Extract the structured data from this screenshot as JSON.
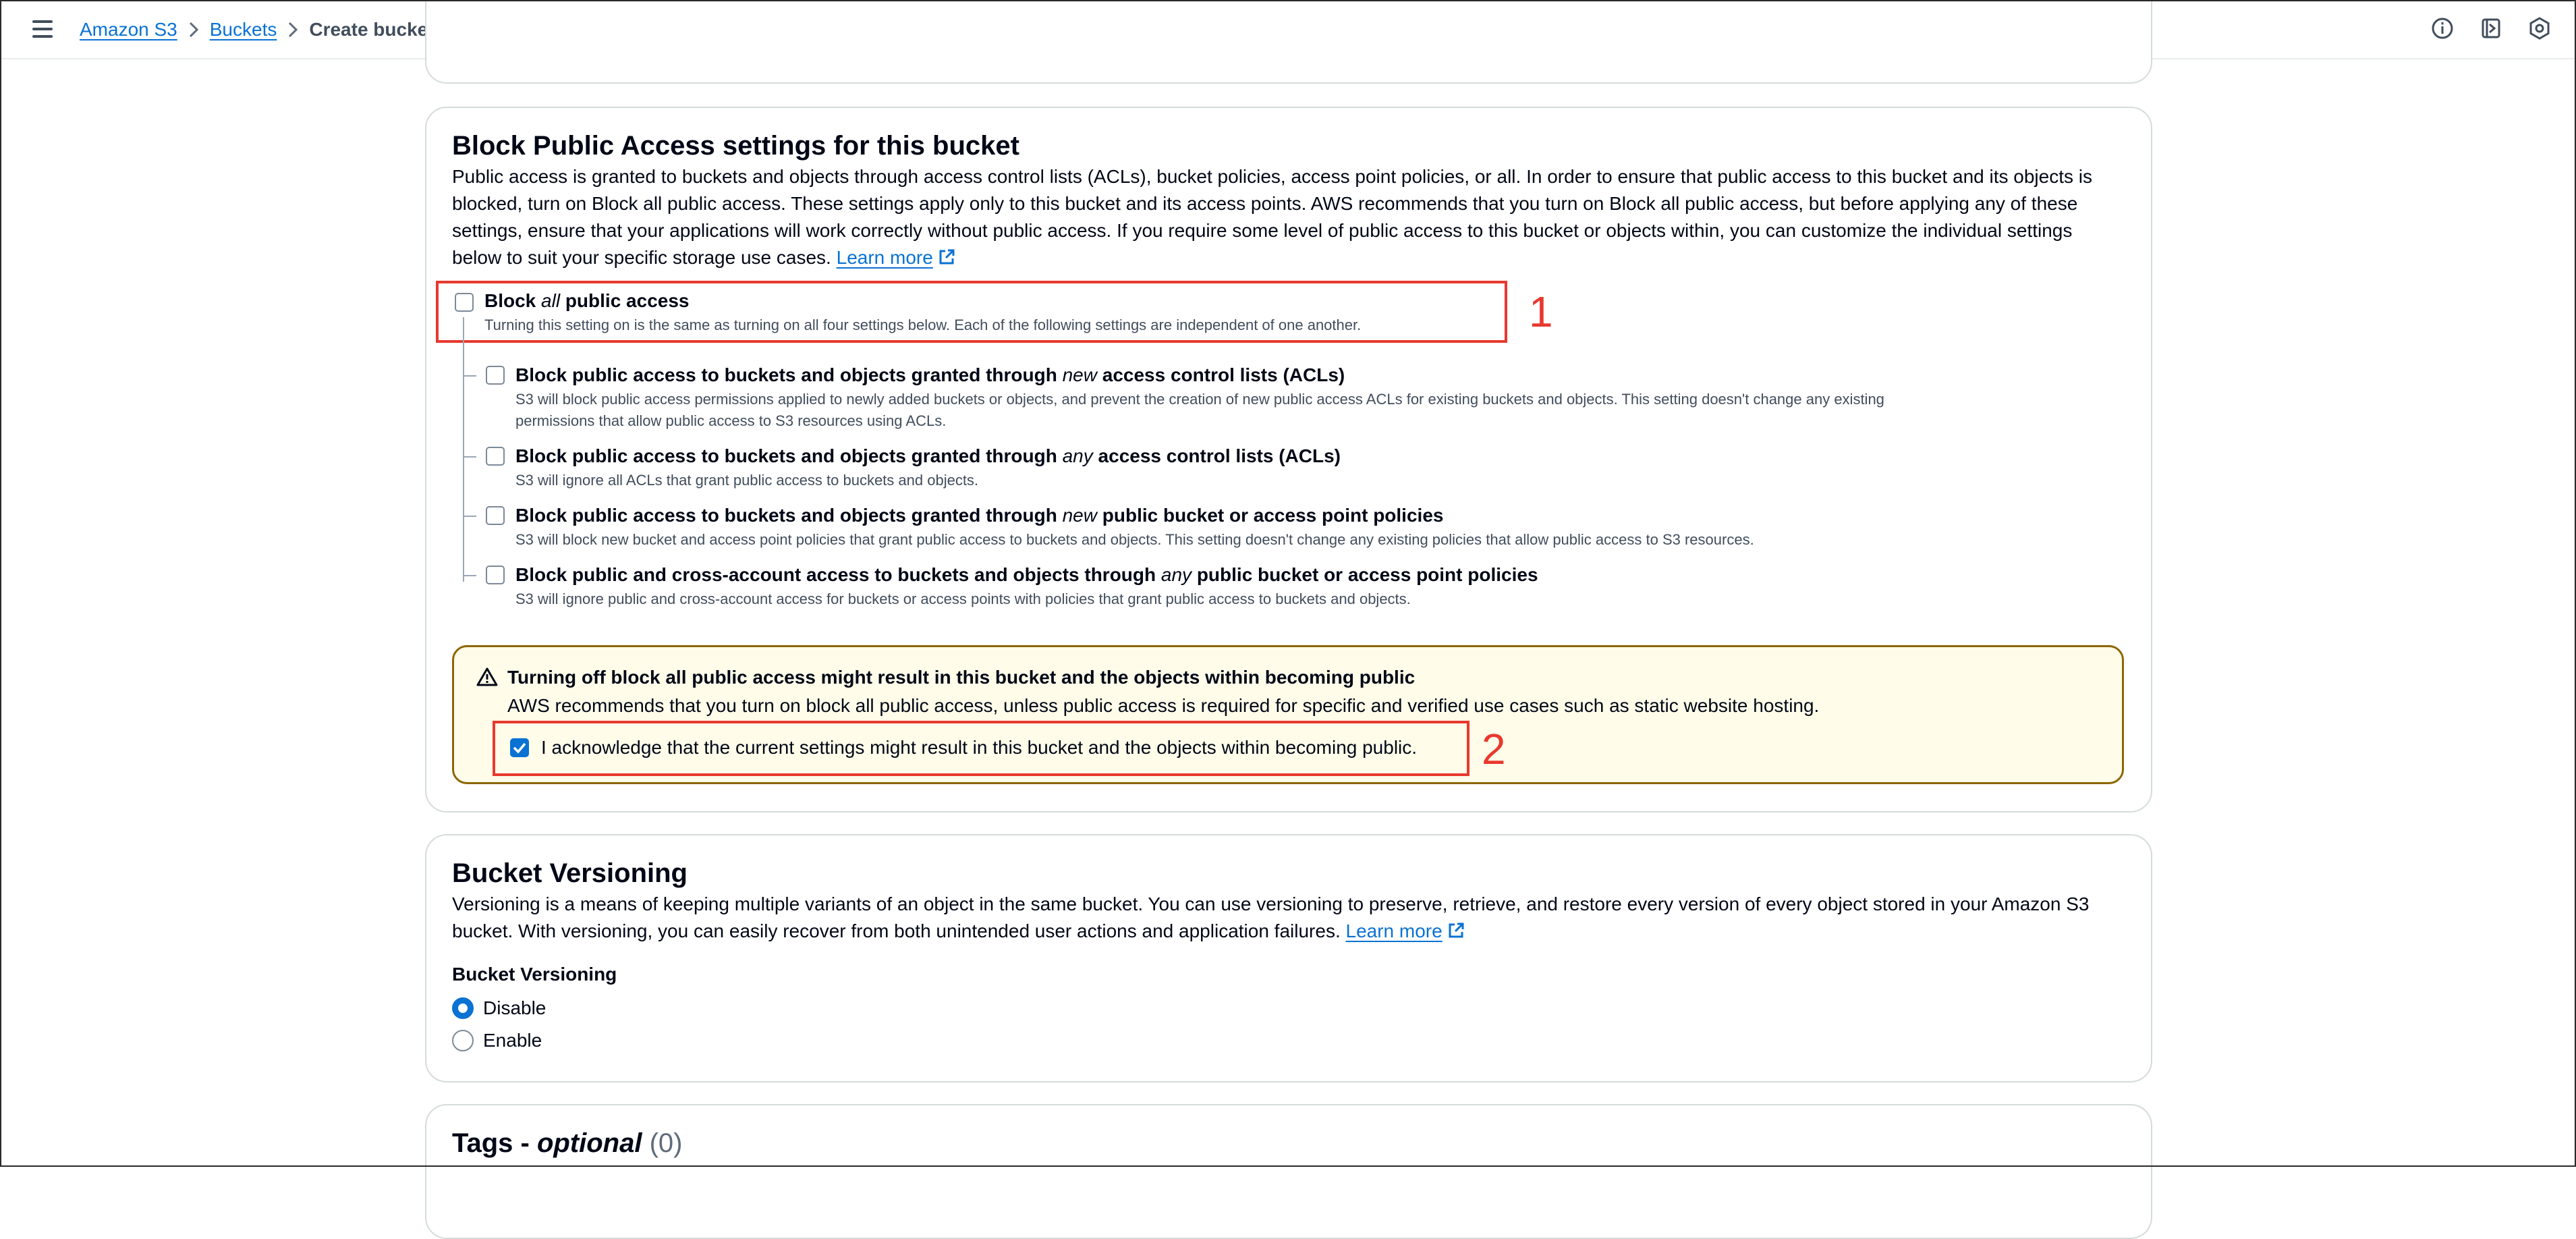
{
  "breadcrumb": {
    "items": [
      "Amazon S3",
      "Buckets"
    ],
    "current": "Create bucket"
  },
  "top_icons": [
    "info-icon",
    "notifications-panel-icon",
    "settings-hexagon-icon"
  ],
  "block_public_access": {
    "title": "Block Public Access settings for this bucket",
    "description_lines": [
      "Public access is granted to buckets and objects through access control lists (ACLs), bucket policies, access point policies, or all. In order to ensure that public access to this bucket and its objects is",
      "blocked, turn on Block all public access. These settings apply only to this bucket and its access points. AWS recommends that you turn on Block all public access, but before applying any of these",
      "settings, ensure that your applications will work correctly without public access. If you require some level of public access to this bucket or objects within, you can customize the individual settings",
      "below to suit your specific storage use cases."
    ],
    "learn_more": "Learn more",
    "block_all": {
      "label_prefix": "Block ",
      "label_italic": "all",
      "label_suffix": " public access",
      "description": "Turning this setting on is the same as turning on all four settings below. Each of the following settings are independent of one another.",
      "checked": false
    },
    "options": [
      {
        "prefix": "Block public access to buckets and objects granted through ",
        "italic": "new",
        "suffix": " access control lists (ACLs)",
        "desc_lines": [
          "S3 will block public access permissions applied to newly added buckets or objects, and prevent the creation of new public access ACLs for existing buckets and objects. This setting doesn't change any existing",
          "permissions that allow public access to S3 resources using ACLs."
        ],
        "checked": false
      },
      {
        "prefix": "Block public access to buckets and objects granted through ",
        "italic": "any",
        "suffix": " access control lists (ACLs)",
        "desc_lines": [
          "S3 will ignore all ACLs that grant public access to buckets and objects."
        ],
        "checked": false
      },
      {
        "prefix": "Block public access to buckets and objects granted through ",
        "italic": "new",
        "suffix": " public bucket or access point policies",
        "desc_lines": [
          "S3 will block new bucket and access point policies that grant public access to buckets and objects. This setting doesn't change any existing policies that allow public access to S3 resources."
        ],
        "checked": false
      },
      {
        "prefix": "Block public and cross-account access to buckets and objects through ",
        "italic": "any",
        "suffix": " public bucket or access point policies",
        "desc_lines": [
          "S3 will ignore public and cross-account access for buckets or access points with policies that grant public access to buckets and objects."
        ],
        "checked": false
      }
    ],
    "warning": {
      "title": "Turning off block all public access might result in this bucket and the objects within becoming public",
      "body": "AWS recommends that you turn on block all public access, unless public access is required for specific and verified use cases such as static website hosting.",
      "acknowledge_label": "I acknowledge that the current settings might result in this bucket and the objects within becoming public.",
      "acknowledged": true
    }
  },
  "annotations": {
    "box1": "1",
    "box2": "2"
  },
  "versioning": {
    "title": "Bucket Versioning",
    "description_lines": [
      "Versioning is a means of keeping multiple variants of an object in the same bucket. You can use versioning to preserve, retrieve, and restore every version of every object stored in your Amazon S3",
      "bucket. With versioning, you can easily recover from both unintended user actions and application failures."
    ],
    "learn_more": "Learn more",
    "field_label": "Bucket Versioning",
    "options": [
      "Disable",
      "Enable"
    ],
    "selected": "Disable"
  },
  "tags": {
    "title_main": "Tags - ",
    "title_italic": "optional",
    "count": "(0)"
  },
  "colors": {
    "link": "#0972d3",
    "annotation_red": "#e8392f",
    "warning_bg": "#fffce9",
    "warning_border": "#8d6605"
  }
}
